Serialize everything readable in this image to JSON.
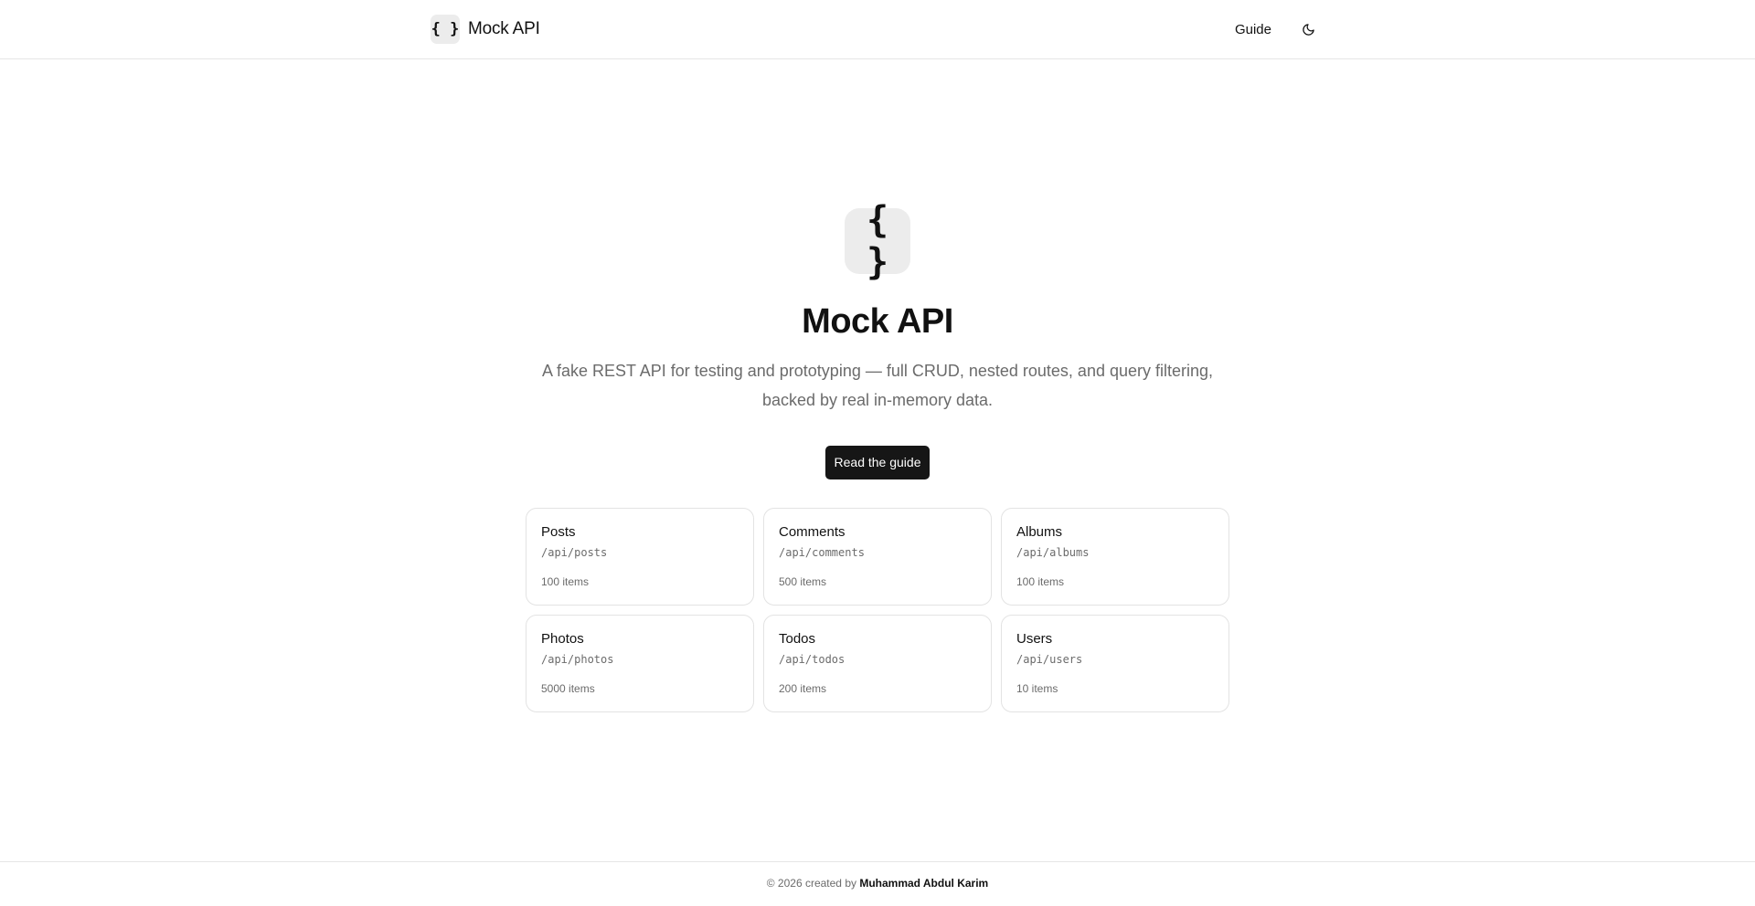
{
  "header": {
    "logo_glyph": "{ }",
    "brand": "Mock API",
    "nav_guide": "Guide",
    "theme_icon": "moon-icon"
  },
  "hero": {
    "logo_glyph": "{ }",
    "title": "Mock API",
    "description": "A fake REST API for testing and prototyping — full CRUD, nested routes, and query filtering, backed by real in-memory data.",
    "cta": "Read the guide"
  },
  "resources": [
    {
      "name": "Posts",
      "path": "/api/posts",
      "count": "100 items"
    },
    {
      "name": "Comments",
      "path": "/api/comments",
      "count": "500 items"
    },
    {
      "name": "Albums",
      "path": "/api/albums",
      "count": "100 items"
    },
    {
      "name": "Photos",
      "path": "/api/photos",
      "count": "5000 items"
    },
    {
      "name": "Todos",
      "path": "/api/todos",
      "count": "200 items"
    },
    {
      "name": "Users",
      "path": "/api/users",
      "count": "10 items"
    }
  ],
  "footer": {
    "prefix": "© 2026 created by",
    "author": "Muhammad Abdul Karim"
  },
  "colors": {
    "primary": "#161616",
    "muted_text": "#6b6b6b",
    "border": "#e3e3e3",
    "logo_bg": "#ececec"
  }
}
